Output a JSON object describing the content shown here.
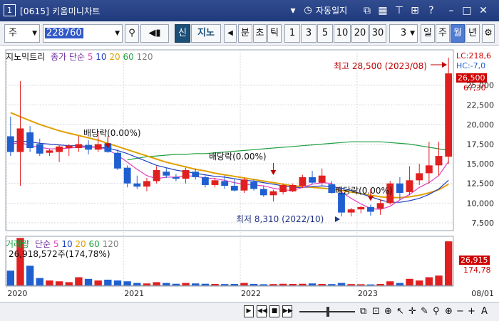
{
  "window": {
    "number": "1",
    "title": "[0615] 키움미니차트",
    "auto_label": "자동일지",
    "auto_icon": "alarm-clock-icon"
  },
  "toolbar": {
    "market": "주",
    "code": "228760",
    "periods": [
      "1",
      "3",
      "5",
      "10",
      "20",
      "30"
    ],
    "interval_value": "3",
    "new_label": "신",
    "jino_label": "지노",
    "min_label": "분",
    "sec_label": "초",
    "tick_label": "틱",
    "day_label": "일",
    "week_label": "주",
    "month_label": "월",
    "year_label": "년"
  },
  "legend_price": {
    "name": "지노믹트리",
    "ma_label": "종가 단순",
    "ma": [
      {
        "period": "5",
        "color": "#e040c0"
      },
      {
        "period": "10",
        "color": "#2040c0"
      },
      {
        "period": "20",
        "color": "#e0a000"
      },
      {
        "period": "60",
        "color": "#20a040"
      },
      {
        "period": "120",
        "color": "#808080"
      }
    ]
  },
  "legend_volume": {
    "name": "거래량",
    "ma_label": "단순",
    "ma": [
      {
        "period": "5",
        "color": "#e040c0"
      },
      {
        "period": "10",
        "color": "#2040c0"
      },
      {
        "period": "20",
        "color": "#e0a000"
      },
      {
        "period": "60",
        "color": "#20a040"
      },
      {
        "period": "120",
        "color": "#808080"
      }
    ],
    "current": "26,918,572주(174,78%)"
  },
  "annotations": {
    "high": "최고 28,500 (2023/08)",
    "low": "최저 8,310 (2022/10)",
    "dividends": [
      "배당락(0.00%)",
      "배당락(0.00%)",
      "배당락(0.00%)"
    ]
  },
  "right_tags": {
    "lc": "LC:218,6",
    "hc": "HC:-7,0",
    "price": "26,500",
    "pct": "67,30",
    "vol": "26,915",
    "vol_pct": "174,78"
  },
  "colors": {
    "up": "#e02020",
    "down": "#1f5fd0",
    "ma5": "#e040c0",
    "ma10": "#2040c0",
    "ma20": "#e0a000",
    "ma60": "#20a040"
  },
  "chart_data": {
    "type": "candlestick",
    "y_ticks": [
      "25,000",
      "22,500",
      "20,000",
      "17,500",
      "15,000",
      "12,500",
      "10,000",
      "7,500"
    ],
    "x_labels": [
      "2020",
      "2021",
      "2022",
      "2023",
      "08/01"
    ],
    "ylim": [
      6500,
      29500
    ],
    "candles": [
      {
        "o": 18500,
        "h": 21000,
        "l": 16000,
        "c": 16500
      },
      {
        "o": 16500,
        "h": 25500,
        "l": 12200,
        "c": 19500
      },
      {
        "o": 19000,
        "h": 19800,
        "l": 16500,
        "c": 17000
      },
      {
        "o": 17500,
        "h": 18200,
        "l": 16000,
        "c": 16300
      },
      {
        "o": 16400,
        "h": 16900,
        "l": 16000,
        "c": 16700
      },
      {
        "o": 16500,
        "h": 17400,
        "l": 15200,
        "c": 17200
      },
      {
        "o": 17000,
        "h": 17500,
        "l": 16000,
        "c": 17300
      },
      {
        "o": 17000,
        "h": 18500,
        "l": 16500,
        "c": 17500
      },
      {
        "o": 17400,
        "h": 18000,
        "l": 16200,
        "c": 16800
      },
      {
        "o": 16800,
        "h": 19000,
        "l": 16500,
        "c": 17500
      },
      {
        "o": 17600,
        "h": 18200,
        "l": 16400,
        "c": 16500
      },
      {
        "o": 16400,
        "h": 16800,
        "l": 14200,
        "c": 14400
      },
      {
        "o": 14500,
        "h": 14800,
        "l": 12000,
        "c": 12500
      },
      {
        "o": 12500,
        "h": 13500,
        "l": 11800,
        "c": 12100
      },
      {
        "o": 12100,
        "h": 13200,
        "l": 11500,
        "c": 12800
      },
      {
        "o": 12800,
        "h": 14700,
        "l": 12500,
        "c": 14200
      },
      {
        "o": 14000,
        "h": 14500,
        "l": 13200,
        "c": 13500
      },
      {
        "o": 13300,
        "h": 13700,
        "l": 12800,
        "c": 13100
      },
      {
        "o": 13100,
        "h": 14500,
        "l": 12500,
        "c": 14200
      },
      {
        "o": 14000,
        "h": 14400,
        "l": 13000,
        "c": 13300
      },
      {
        "o": 13300,
        "h": 13600,
        "l": 12000,
        "c": 12300
      },
      {
        "o": 12300,
        "h": 13200,
        "l": 12000,
        "c": 12900
      },
      {
        "o": 12800,
        "h": 13500,
        "l": 11800,
        "c": 12200
      },
      {
        "o": 12200,
        "h": 13000,
        "l": 11500,
        "c": 11600
      },
      {
        "o": 11600,
        "h": 13200,
        "l": 11300,
        "c": 13000
      },
      {
        "o": 12700,
        "h": 13000,
        "l": 11600,
        "c": 11800
      },
      {
        "o": 11800,
        "h": 12200,
        "l": 10800,
        "c": 11000
      },
      {
        "o": 11000,
        "h": 11700,
        "l": 10200,
        "c": 11500
      },
      {
        "o": 11400,
        "h": 12500,
        "l": 11100,
        "c": 12300
      },
      {
        "o": 11500,
        "h": 12500,
        "l": 11400,
        "c": 12300
      },
      {
        "o": 12200,
        "h": 13600,
        "l": 11900,
        "c": 13300
      },
      {
        "o": 13300,
        "h": 14100,
        "l": 12400,
        "c": 12600
      },
      {
        "o": 12600,
        "h": 14400,
        "l": 12300,
        "c": 13500
      },
      {
        "o": 12400,
        "h": 12800,
        "l": 11200,
        "c": 11300
      },
      {
        "o": 11300,
        "h": 11500,
        "l": 8300,
        "c": 8800
      },
      {
        "o": 8800,
        "h": 9400,
        "l": 8300,
        "c": 9200
      },
      {
        "o": 9200,
        "h": 9600,
        "l": 8700,
        "c": 9500
      },
      {
        "o": 9500,
        "h": 9800,
        "l": 8400,
        "c": 8900
      },
      {
        "o": 9300,
        "h": 10500,
        "l": 8500,
        "c": 10000
      },
      {
        "o": 10000,
        "h": 12800,
        "l": 9800,
        "c": 12500
      },
      {
        "o": 12500,
        "h": 13300,
        "l": 10400,
        "c": 11300
      },
      {
        "o": 11400,
        "h": 14700,
        "l": 11000,
        "c": 12900
      },
      {
        "o": 12900,
        "h": 15000,
        "l": 12300,
        "c": 13800
      },
      {
        "o": 13800,
        "h": 17800,
        "l": 12500,
        "c": 14800
      },
      {
        "o": 14800,
        "h": 17800,
        "l": 13500,
        "c": 16000
      },
      {
        "o": 15900,
        "h": 28500,
        "l": 15000,
        "c": 26500
      }
    ],
    "ma5": [
      17500,
      17700,
      17300,
      17100,
      16900,
      16900,
      17000,
      17100,
      17100,
      17100,
      16800,
      16100,
      15200,
      14300,
      13500,
      13100,
      13300,
      13300,
      13500,
      13400,
      13200,
      13100,
      12900,
      12600,
      12400,
      12300,
      12200,
      11900,
      11700,
      11600,
      12000,
      12400,
      12600,
      12500,
      11400,
      10600,
      9900,
      9300,
      9200,
      9600,
      10400,
      11100,
      12000,
      12600,
      13500,
      15300
    ],
    "ma10": [
      17800,
      17900,
      17800,
      17600,
      17500,
      17400,
      17300,
      17300,
      17200,
      17100,
      17000,
      16700,
      16300,
      15800,
      15300,
      14800,
      14500,
      14200,
      14000,
      13800,
      13600,
      13400,
      13300,
      13100,
      12900,
      12800,
      12600,
      12400,
      12200,
      12000,
      12000,
      12100,
      12200,
      12100,
      11900,
      11600,
      11200,
      10800,
      10400,
      10100,
      10100,
      10300,
      10600,
      11100,
      11800,
      12900
    ],
    "ma20": [
      21500,
      21000,
      20500,
      20000,
      19600,
      19200,
      18900,
      18600,
      18300,
      18000,
      17600,
      17200,
      16800,
      16400,
      16000,
      15600,
      15200,
      14900,
      14600,
      14300,
      14100,
      13800,
      13600,
      13400,
      13200,
      13000,
      12800,
      12600,
      12400,
      12200,
      12100,
      12000,
      11900,
      11800,
      11600,
      11400,
      11200,
      11000,
      10800,
      10700,
      10700,
      10800,
      11000,
      11300,
      11700,
      12400
    ],
    "ma60": [
      null,
      null,
      null,
      null,
      null,
      null,
      null,
      null,
      null,
      null,
      null,
      null,
      15500,
      15700,
      15900,
      16000,
      16100,
      16200,
      16200,
      16300,
      16300,
      16400,
      16500,
      16600,
      16700,
      16800,
      16900,
      17000,
      17100,
      17200,
      17300,
      17400,
      17500,
      17600,
      17700,
      17800,
      17800,
      17800,
      17800,
      17700,
      17600,
      17500,
      17300,
      17100,
      16900,
      16700
    ],
    "volume_ylim": [
      0,
      30000000
    ],
    "volumes": [
      9000000,
      29000000,
      12000000,
      4500000,
      3000000,
      2500000,
      2000000,
      5000000,
      4000000,
      3000000,
      3500000,
      3000000,
      2500000,
      1500000,
      1200000,
      2000000,
      1500000,
      1000000,
      1500000,
      1200000,
      1000000,
      900000,
      800000,
      900000,
      1500000,
      900000,
      700000,
      800000,
      1000000,
      900000,
      1000000,
      1200000,
      900000,
      800000,
      1500000,
      800000,
      700000,
      600000,
      900000,
      2500000,
      1500000,
      4000000,
      3000000,
      5000000,
      6000000,
      26918572
    ],
    "volume_up": [
      false,
      true,
      false,
      false,
      true,
      true,
      true,
      true,
      false,
      true,
      false,
      false,
      false,
      false,
      true,
      true,
      false,
      false,
      true,
      false,
      false,
      true,
      false,
      false,
      true,
      false,
      false,
      true,
      true,
      true,
      true,
      false,
      true,
      false,
      false,
      true,
      true,
      false,
      true,
      true,
      false,
      true,
      true,
      true,
      true,
      true
    ]
  }
}
